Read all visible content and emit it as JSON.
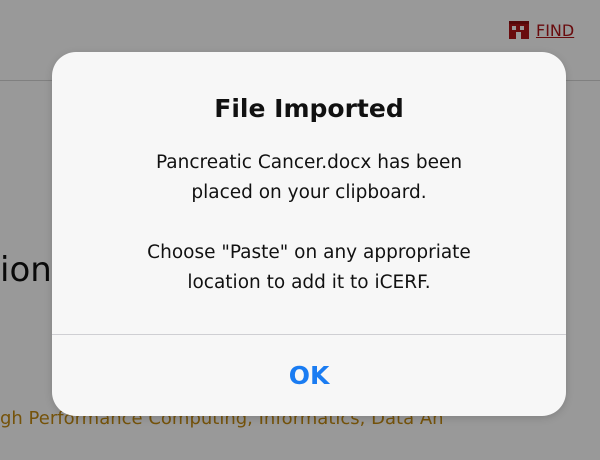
{
  "background": {
    "find_link": "FIND",
    "heading_fragment": "ion",
    "tagline": "gh Performance Computing, Informatics, Data An"
  },
  "alert": {
    "title": "File Imported",
    "message_line_1": "Pancreatic Cancer.docx has been",
    "message_line_2": "placed on your clipboard.",
    "message_line_3": "Choose \"Paste\" on any appropriate",
    "message_line_4": "location to add it to iCERF.",
    "ok_label": "OK"
  },
  "colors": {
    "link_red": "#b01418",
    "ok_blue": "#1a7cf2",
    "tagline_gold": "#c48a12"
  },
  "icons": {
    "find_icon": "building-icon"
  }
}
